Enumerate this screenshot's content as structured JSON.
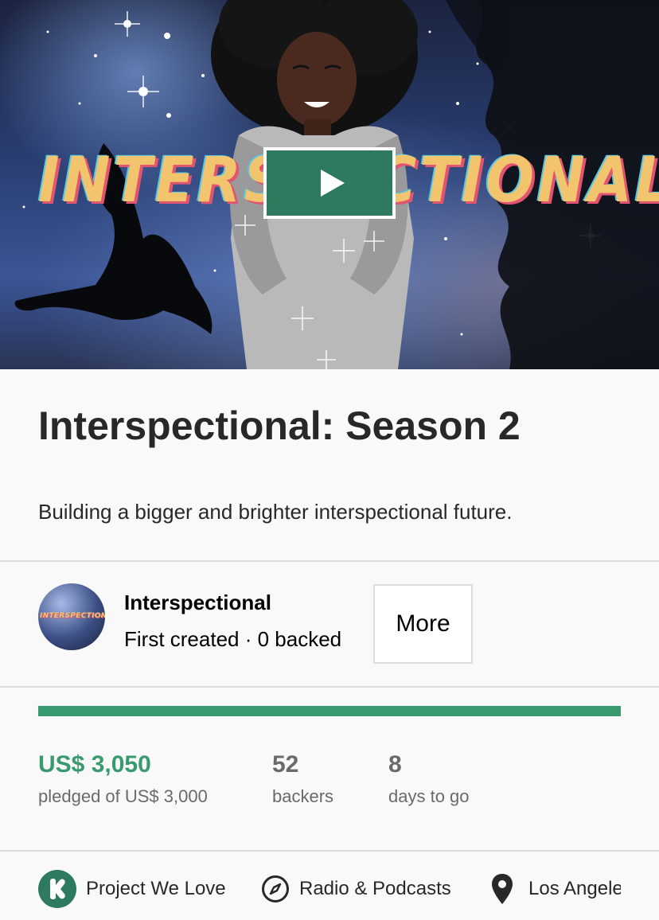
{
  "hero": {
    "title_text": "INTERSPECTIONAL",
    "video": {
      "play_icon": "play-icon"
    }
  },
  "project": {
    "title": "Interspectional: Season 2",
    "blurb": "Building a bigger and brighter interspectional future."
  },
  "creator": {
    "name": "Interspectional",
    "stats": "First created · 0 backed",
    "avatar_text": "INTERSPECTIONAL",
    "more_label": "More"
  },
  "funding": {
    "progress_percent": 100,
    "pledged": "US$ 3,050",
    "pledged_label": "pledged of US$ 3,000",
    "backers": "52",
    "backers_label": "backers",
    "days": "8",
    "days_label": "days to go"
  },
  "meta": {
    "project_we_love": "Project We Love",
    "category": "Radio & Podcasts",
    "location": "Los Angeles"
  },
  "colors": {
    "accent_green": "#2d7a5e",
    "progress_green": "#3a9a6f",
    "pledged_green": "#3a9a6f",
    "hero_title_yellow": "#f2c46d"
  }
}
